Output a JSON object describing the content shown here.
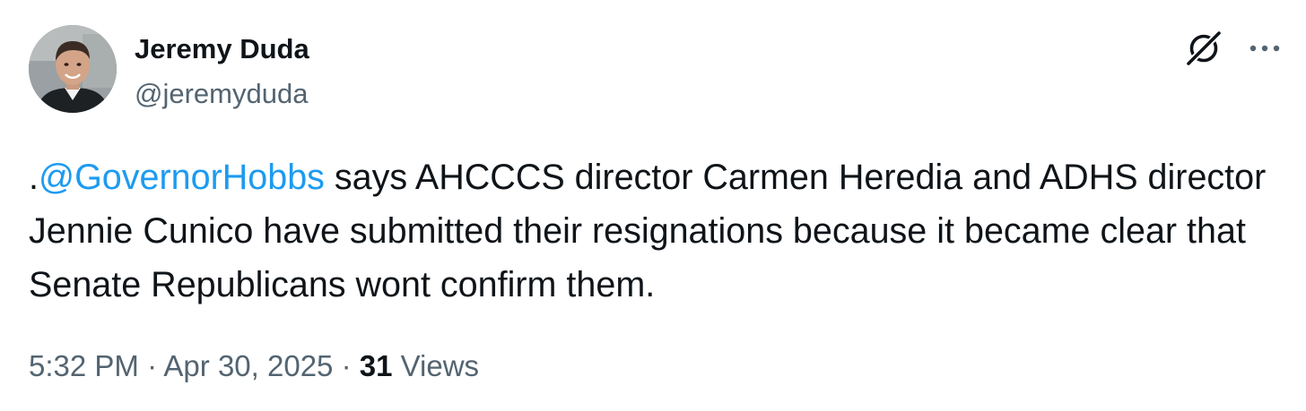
{
  "author": {
    "display_name": "Jeremy Duda",
    "handle": "@jeremyduda"
  },
  "header_icons": {
    "grok": "grok-icon",
    "more": "more-icon"
  },
  "tweet": {
    "prefix": ".",
    "mention": "@GovernorHobbs",
    "text": " says AHCCCS director Carmen Heredia and ADHS director Jennie Cunico have submitted their resignations because it became clear that Senate Republicans wont confirm them."
  },
  "meta": {
    "time": "5:32 PM",
    "separator": " · ",
    "date": "Apr 30, 2025",
    "views_count": "31",
    "views_label": "Views"
  },
  "colors": {
    "text": "#0f1419",
    "secondary": "#536471",
    "link": "#1d9bf0"
  }
}
